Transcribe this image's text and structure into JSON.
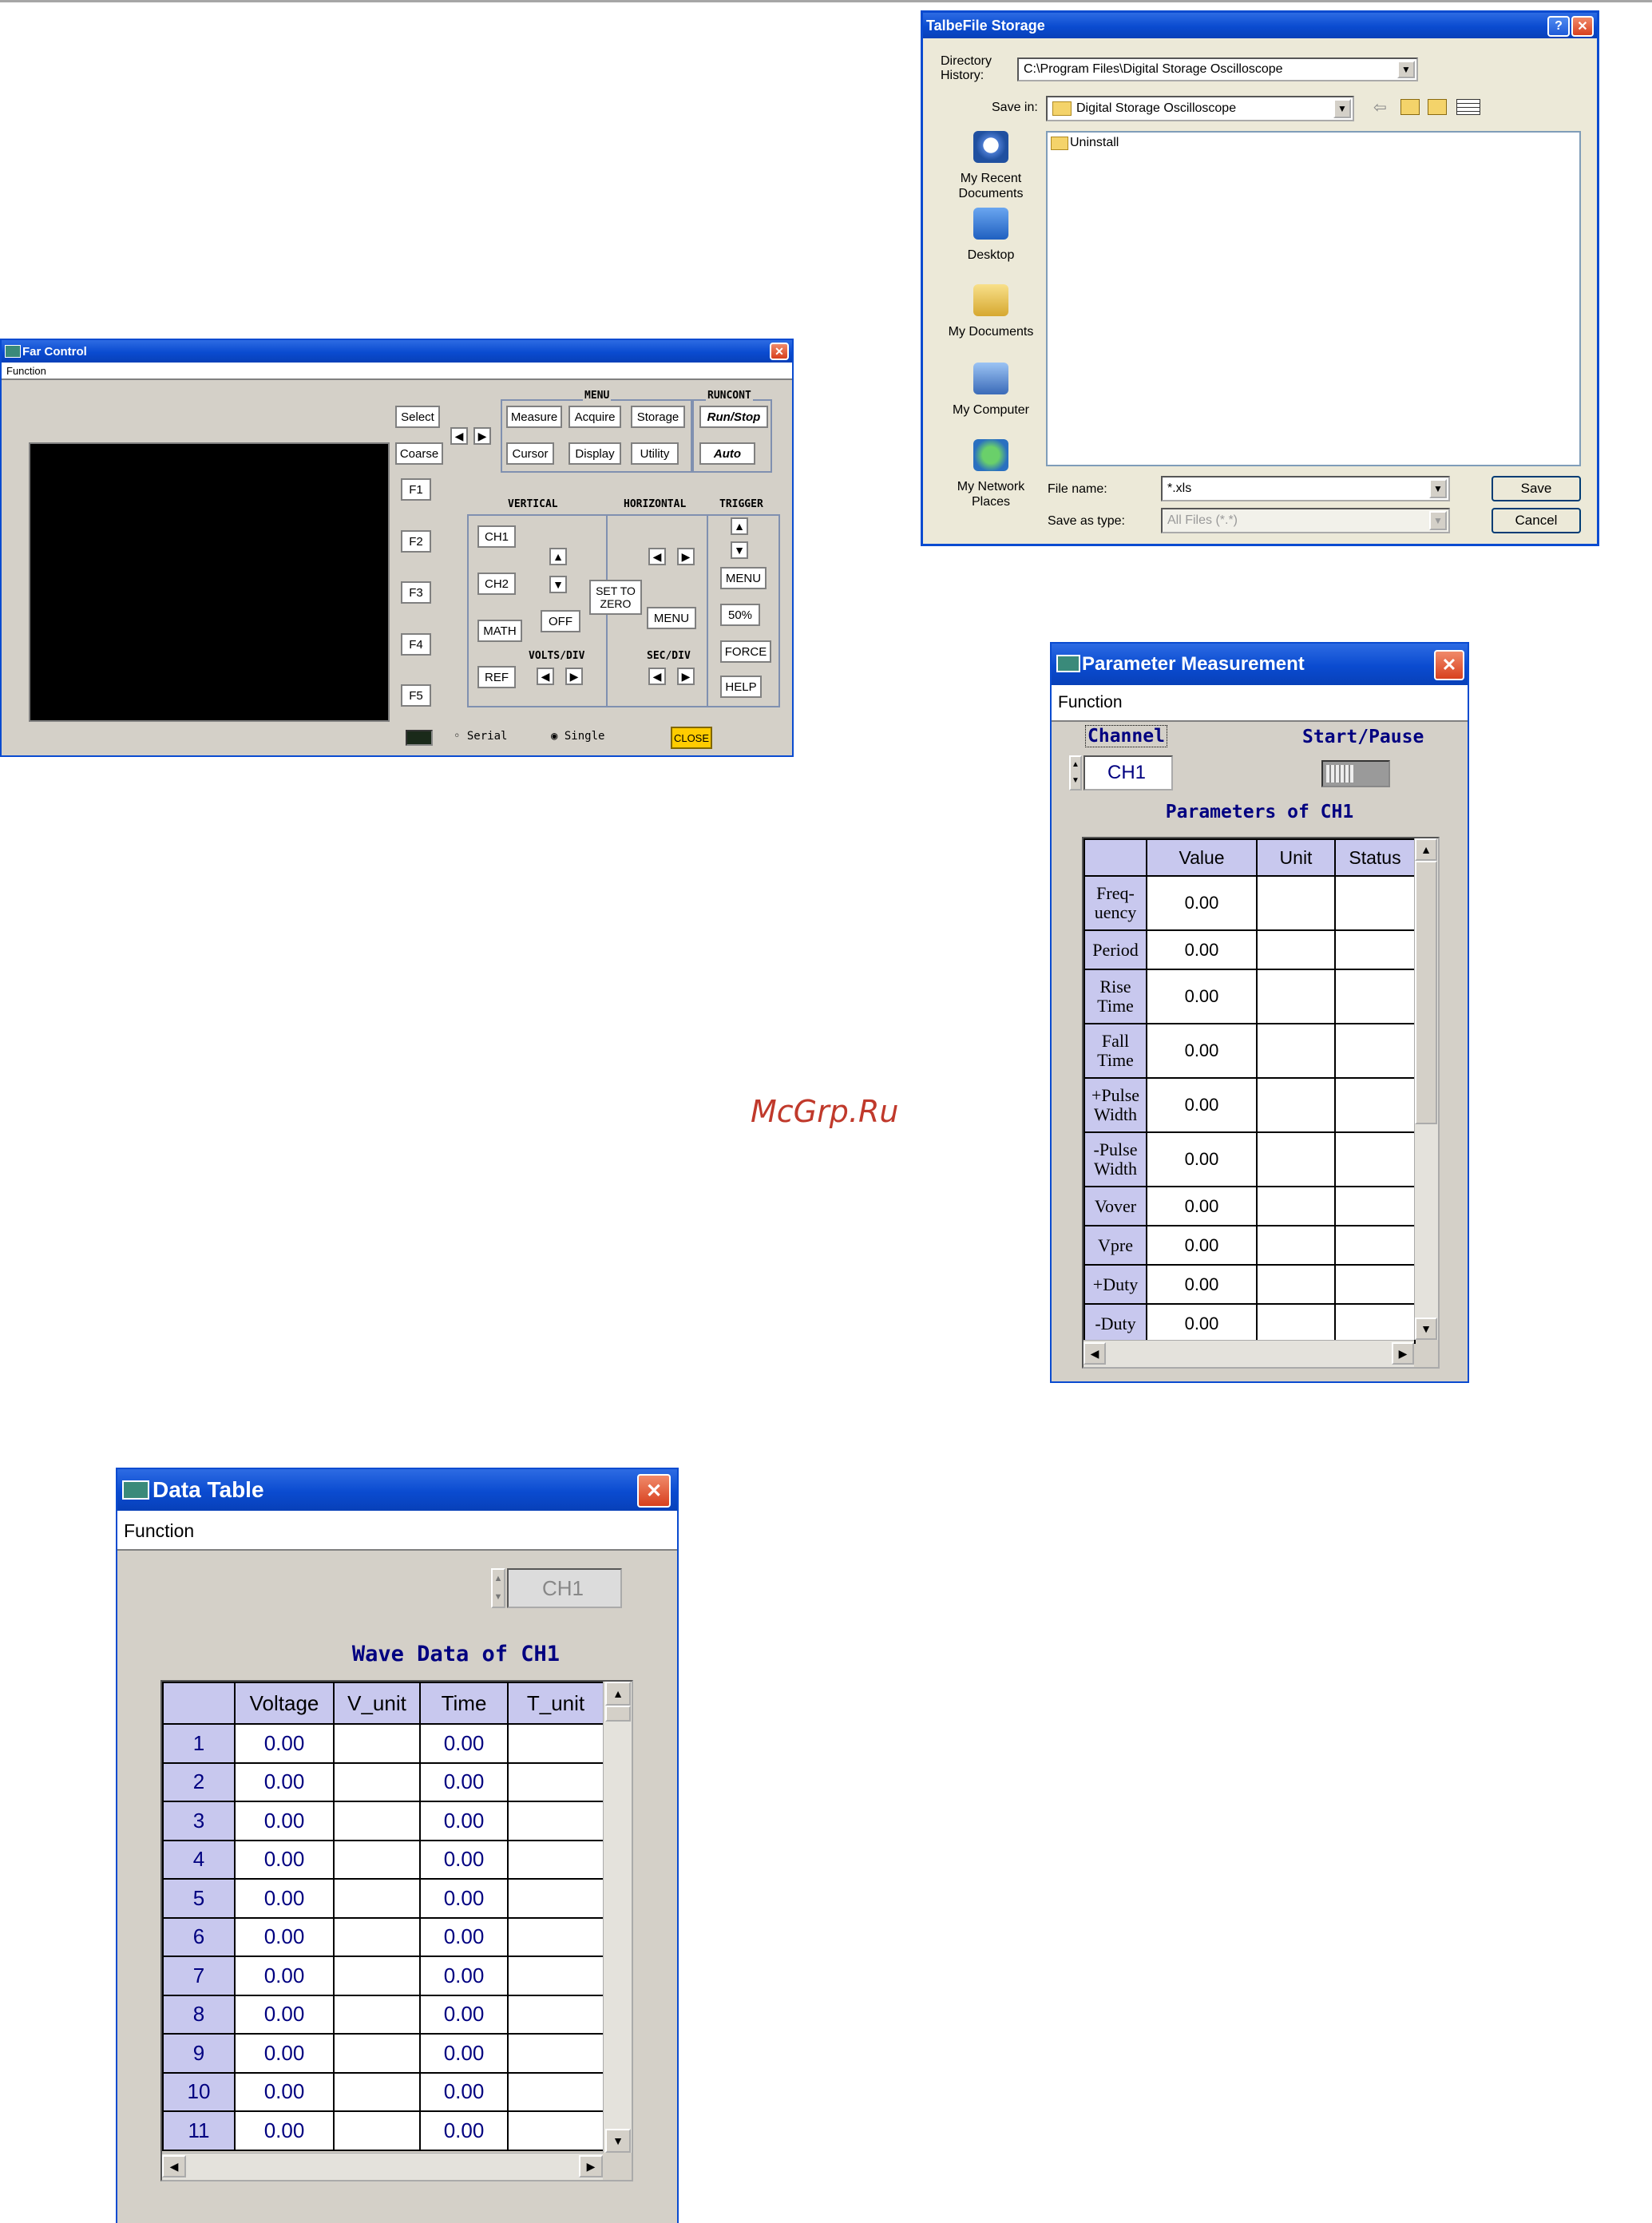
{
  "far_control": {
    "title": "Far Control",
    "menu": "Function",
    "left_buttons": [
      "Select",
      "Coarse",
      "F1",
      "F2",
      "F3",
      "F4",
      "F5"
    ],
    "menu_group": {
      "label": "MENU",
      "buttons": [
        "Measure",
        "Acquire",
        "Storage",
        "Cursor",
        "Display",
        "Utility"
      ]
    },
    "runcont_group": {
      "label": "RUNCONT",
      "buttons": [
        "Run/Stop",
        "Auto"
      ]
    },
    "vertical": {
      "label": "VERTICAL",
      "buttons": [
        "CH1",
        "CH2",
        "MATH",
        "REF"
      ],
      "off": "OFF",
      "volts_div": "VOLTS/DIV"
    },
    "horizontal": {
      "label": "HORIZONTAL",
      "set_to_zero": "SET TO ZERO",
      "menu": "MENU",
      "sec_div": "SEC/DIV"
    },
    "trigger": {
      "label": "TRIGGER",
      "buttons": [
        "MENU",
        "50%",
        "FORCE",
        "HELP"
      ]
    },
    "serial": "Serial",
    "single": "Single",
    "close": "CLOSE"
  },
  "file_storage": {
    "title": "TalbeFile Storage",
    "directory_history_label": "Directory History:",
    "directory_history_value": "C:\\Program Files\\Digital Storage Oscilloscope",
    "save_in_label": "Save in:",
    "save_in_value": "Digital Storage Oscilloscope",
    "places": [
      "My Recent Documents",
      "Desktop",
      "My Documents",
      "My Computer",
      "My Network Places"
    ],
    "files": [
      "Uninstall"
    ],
    "file_name_label": "File name:",
    "file_name_value": "*.xls",
    "save_as_type_label": "Save as type:",
    "save_as_type_value": "All Files (*.*)",
    "save_button": "Save",
    "cancel_button": "Cancel"
  },
  "parameter_measurement": {
    "title": "Parameter Measurement",
    "menu": "Function",
    "channel_label": "Channel",
    "channel_value": "CH1",
    "start_pause_label": "Start/Pause",
    "table_title": "Parameters of CH1",
    "columns": [
      "Value",
      "Unit",
      "Status"
    ],
    "rows": [
      {
        "name": "Freq-\nuency",
        "value": "0.00"
      },
      {
        "name": "Period",
        "value": "0.00"
      },
      {
        "name": "Rise\nTime",
        "value": "0.00"
      },
      {
        "name": "Fall\nTime",
        "value": "0.00"
      },
      {
        "name": "+Pulse\nWidth",
        "value": "0.00"
      },
      {
        "name": "-Pulse\nWidth",
        "value": "0.00"
      },
      {
        "name": "Vover",
        "value": "0.00"
      },
      {
        "name": "Vpre",
        "value": "0.00"
      },
      {
        "name": "+Duty",
        "value": "0.00"
      },
      {
        "name": "-Duty",
        "value": "0.00"
      }
    ]
  },
  "data_table": {
    "title": "Data Table",
    "menu": "Function",
    "channel_value": "CH1",
    "table_title": "Wave Data of CH1",
    "columns": [
      "Voltage",
      "V_unit",
      "Time",
      "T_unit"
    ],
    "rows": [
      {
        "n": "1",
        "voltage": "0.00",
        "time": "0.00"
      },
      {
        "n": "2",
        "voltage": "0.00",
        "time": "0.00"
      },
      {
        "n": "3",
        "voltage": "0.00",
        "time": "0.00"
      },
      {
        "n": "4",
        "voltage": "0.00",
        "time": "0.00"
      },
      {
        "n": "5",
        "voltage": "0.00",
        "time": "0.00"
      },
      {
        "n": "6",
        "voltage": "0.00",
        "time": "0.00"
      },
      {
        "n": "7",
        "voltage": "0.00",
        "time": "0.00"
      },
      {
        "n": "8",
        "voltage": "0.00",
        "time": "0.00"
      },
      {
        "n": "9",
        "voltage": "0.00",
        "time": "0.00"
      },
      {
        "n": "10",
        "voltage": "0.00",
        "time": "0.00"
      },
      {
        "n": "11",
        "voltage": "0.00",
        "time": "0.00"
      }
    ]
  },
  "watermark": "McGrp.Ru",
  "colors": {
    "titlebar": "#0a4bd0",
    "window": "#d4d0c8",
    "header_cell": "#c8c8ee",
    "table_text": "#000080",
    "close_button": "#ffcc00",
    "watermark": "#c0392b"
  }
}
